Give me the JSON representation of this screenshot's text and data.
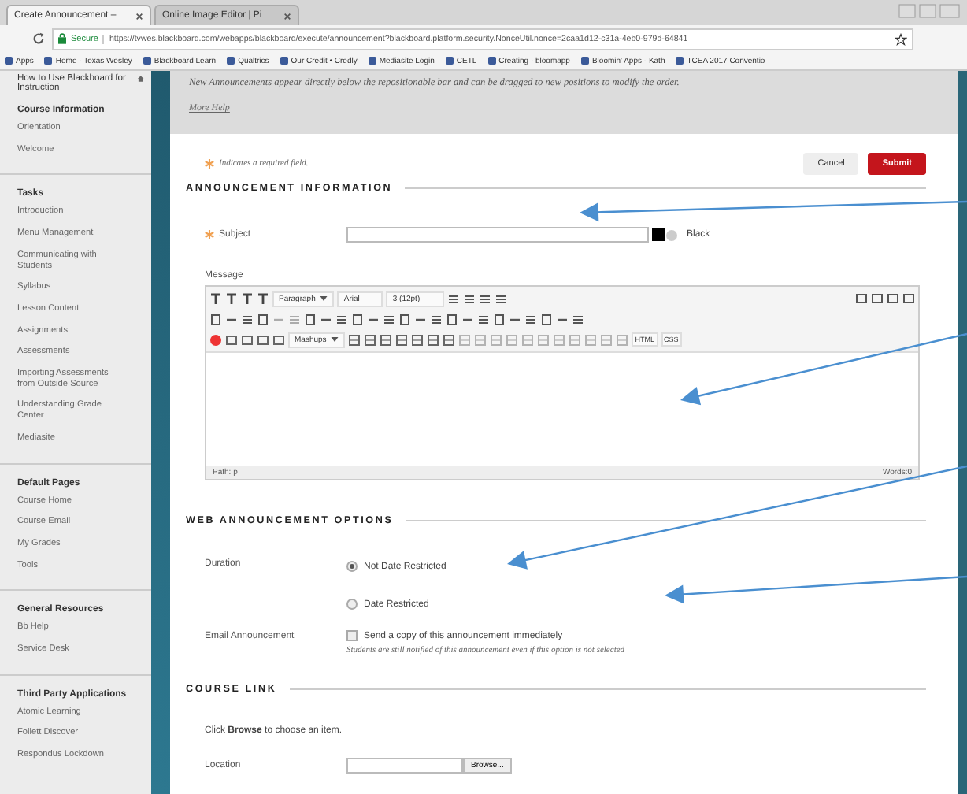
{
  "browser": {
    "tabs": [
      {
        "label": "Create Announcement –",
        "selected": true
      },
      {
        "label": "Online Image Editor | Pi",
        "selected": false
      }
    ],
    "address": {
      "secure_label": "Secure",
      "url": "https://tvwes.blackboard.com/webapps/blackboard/execute/announcement?blackboard.platform.security.NonceUtil.nonce=2caa1d12-c31a-4eb0-979d-64841"
    },
    "bookmarks": [
      "Apps",
      "Home - Texas Wesley",
      "Blackboard Learn",
      "Qualtrics",
      "Our Credit • Credly",
      "Mediasite Login",
      "CETL",
      "Creating - bloomapp",
      "Bloomin' Apps - Kath",
      "TCEA 2017 Conventio"
    ]
  },
  "sidebar": {
    "course_title": "How to Use Blackboard for Instruction",
    "sections": [
      {
        "heading": "Course Information",
        "items": [
          "Orientation",
          "Welcome"
        ]
      },
      {
        "heading": "Tasks",
        "items": [
          "Introduction",
          "Menu Management",
          "Communicating with Students",
          "Syllabus",
          "Lesson Content",
          "Assignments",
          "Assessments",
          "Importing Assessments from Outside Source",
          "Understanding Grade Center",
          "Mediasite"
        ]
      },
      {
        "heading": "Default Pages",
        "items": [
          "Course Home",
          "Course Email",
          "My Grades",
          "Tools"
        ]
      },
      {
        "heading": "General Resources",
        "items": [
          "Bb Help",
          "Service Desk"
        ]
      },
      {
        "heading": "Third Party Applications",
        "items": [
          "Atomic Learning",
          "Follett Discover",
          "Respondus Lockdown"
        ]
      }
    ]
  },
  "help": {
    "text": "New Announcements appear directly below the repositionable bar and can be dragged to new positions to modify the order.",
    "link": "More Help"
  },
  "required_note": {
    "text": "Indicates a required field."
  },
  "buttons": [
    {
      "label": "Cancel",
      "kind": "secondary"
    },
    {
      "label": "Submit",
      "kind": "primary"
    }
  ],
  "announcement_info": {
    "heading": "ANNOUNCEMENT INFORMATION",
    "subject": {
      "label": "Subject",
      "required": true,
      "color_name": "Black"
    },
    "message": {
      "label": "Message",
      "toolbar": {
        "paragraph": "Paragraph",
        "font": "Arial",
        "size": "3 (12pt)",
        "mashups": "Mashups",
        "html": "HTML",
        "css": "CSS"
      },
      "path": "Path: p",
      "words": "Words:0"
    }
  },
  "web_options": {
    "heading": "WEB ANNOUNCEMENT OPTIONS",
    "duration_label": "Duration",
    "durations": [
      {
        "label": "Not Date Restricted",
        "selected": true
      },
      {
        "label": "Date Restricted",
        "selected": false
      }
    ],
    "email": {
      "label": "Email Announcement",
      "option": "Send a copy of this announcement immediately",
      "checked": false,
      "note": "Students are still notified of this announcement even if this option is not selected"
    }
  },
  "course_link": {
    "heading": "COURSE LINK",
    "instruction": "Click **Browse** to choose an item.",
    "location_label": "Location",
    "browse": "Browse..."
  }
}
